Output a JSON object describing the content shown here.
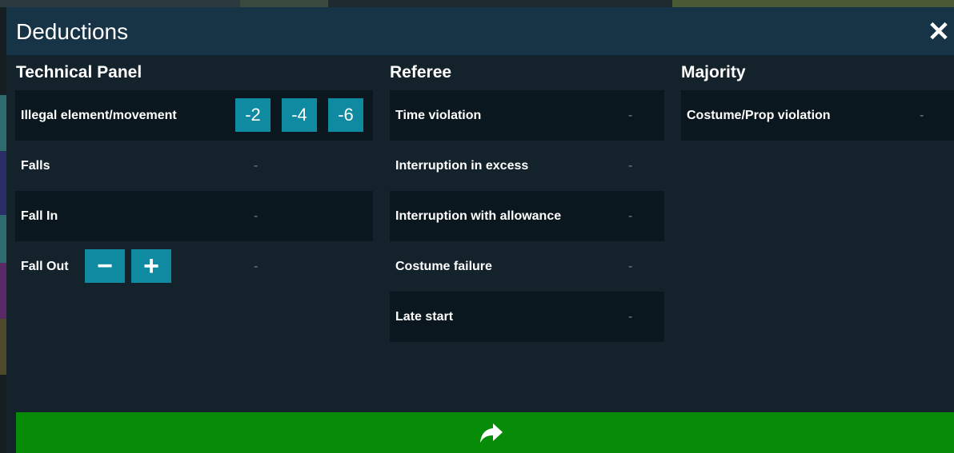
{
  "dialog": {
    "title": "Deductions",
    "close_icon": "close-icon",
    "next_icon": "forward-arrow-icon"
  },
  "technical_panel": {
    "heading": "Technical Panel",
    "illegal_element": {
      "label": "Illegal element/movement",
      "buttons": [
        "-2",
        "-4",
        "-6"
      ]
    },
    "falls": {
      "label": "Falls",
      "value": "-"
    },
    "fall_in": {
      "label": "Fall In",
      "value": "-"
    },
    "fall_out": {
      "label": "Fall Out",
      "value": "-",
      "decrement_icon": "minus-icon",
      "increment_icon": "plus-icon"
    }
  },
  "referee": {
    "heading": "Referee",
    "items": [
      {
        "label": "Time violation",
        "value": "-"
      },
      {
        "label": "Interruption in excess",
        "value": "-"
      },
      {
        "label": "Interruption with allowance",
        "value": "-"
      },
      {
        "label": "Costume failure",
        "value": "-"
      },
      {
        "label": "Late start",
        "value": "-"
      }
    ]
  },
  "majority": {
    "heading": "Majority",
    "items": [
      {
        "label": "Costume/Prop violation",
        "value": "-"
      }
    ]
  },
  "colors": {
    "header_bg": "#173447",
    "body_bg": "#14222b",
    "row_dark": "#0b171e",
    "button": "#0f8aa0",
    "footer_green": "#078c08"
  }
}
